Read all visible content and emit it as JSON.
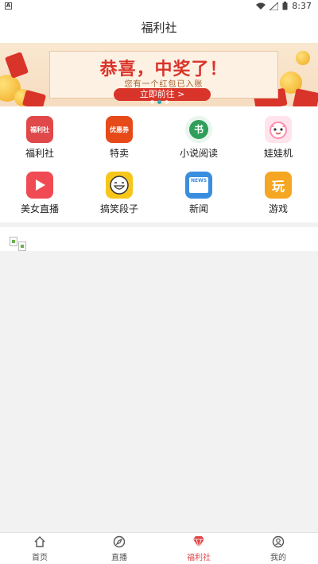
{
  "status_bar": {
    "time": "8:37",
    "indicator": "A"
  },
  "title": "福利社",
  "banner": {
    "headline": "恭喜，中奖了！",
    "subline": "您有一个红包已入账",
    "button_label": "立即前往 >"
  },
  "grid": [
    {
      "label": "福利社",
      "icon": "fulishe-app-icon",
      "color": "#e0484a",
      "text": "福利社"
    },
    {
      "label": "特卖",
      "icon": "coupon-app-icon",
      "color": "#e64a19",
      "text": "优惠券"
    },
    {
      "label": "小说阅读",
      "icon": "book-app-icon",
      "color": "#2f9e5a",
      "text": "书"
    },
    {
      "label": "娃娃机",
      "icon": "cat-app-icon",
      "color": "#ff8fb0",
      "text": ""
    },
    {
      "label": "美女直播",
      "icon": "live-app-icon",
      "color": "#f04b54",
      "text": ""
    },
    {
      "label": "搞笑段子",
      "icon": "joke-app-icon",
      "color": "#f6c61b",
      "text": ""
    },
    {
      "label": "新闻",
      "icon": "news-app-icon",
      "color": "#3a8ee0",
      "text": "NEWS"
    },
    {
      "label": "游戏",
      "icon": "game-app-icon",
      "color": "#f5a623",
      "text": "玩"
    }
  ],
  "tabs": [
    {
      "label": "首页",
      "icon": "home-icon",
      "active": false
    },
    {
      "label": "直播",
      "icon": "compass-icon",
      "active": false
    },
    {
      "label": "福利社",
      "icon": "gem-icon",
      "active": true
    },
    {
      "label": "我的",
      "icon": "user-icon",
      "active": false
    }
  ],
  "colors": {
    "accent": "#e0484a",
    "banner_red": "#d9342a"
  }
}
